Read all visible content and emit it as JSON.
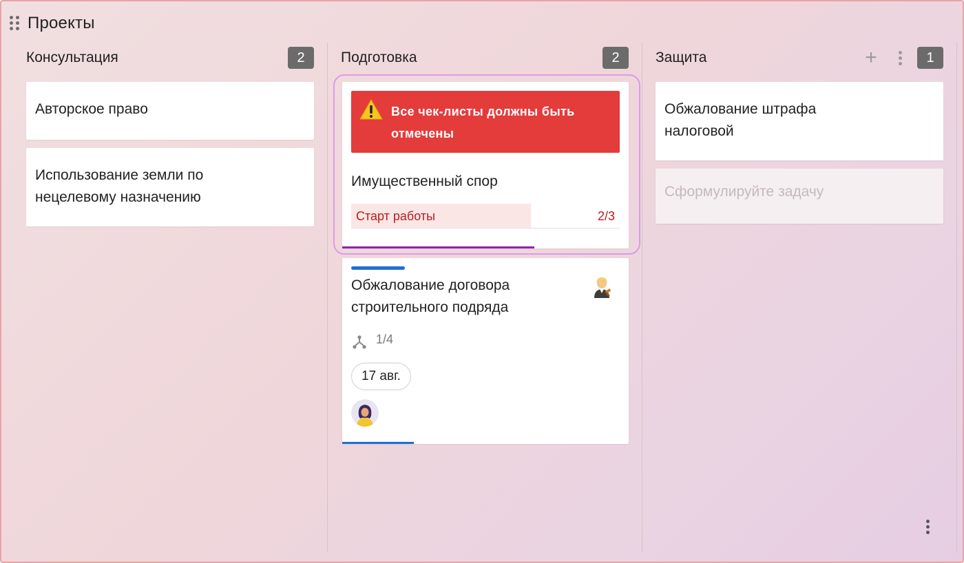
{
  "board": {
    "title": "Проекты"
  },
  "columns": [
    {
      "title": "Консультация",
      "count": "2",
      "cards": [
        {
          "text": "Авторское право"
        },
        {
          "text": "Использование земли по нецелевому назначению"
        }
      ]
    },
    {
      "title": "Подготовка",
      "count": "2",
      "selected_card": {
        "warning": "Все чек-листы должны быть отмечены",
        "text": "Имущественный спор",
        "checklist_label": "Старт работы",
        "checklist_count": "2/3",
        "checklist_progress": 0.67
      },
      "card2": {
        "label_color": "#1e6fd4",
        "text": "Обжалование договора строительного подряда",
        "assignee_emoji": "man-judge-emoji",
        "subtasks": "1/4",
        "date": "17 авг.",
        "progress": 0.25
      }
    },
    {
      "title": "Защита",
      "count": "1",
      "add_icon": "+",
      "cards": [
        {
          "text": "Обжалование штрафа налоговой"
        }
      ],
      "new_card_placeholder": "Сформулируйте задачу"
    }
  ],
  "colors": {
    "warning": "#e43b3b",
    "accent": "#8e24aa",
    "progress_blue": "#1e6fd4"
  }
}
